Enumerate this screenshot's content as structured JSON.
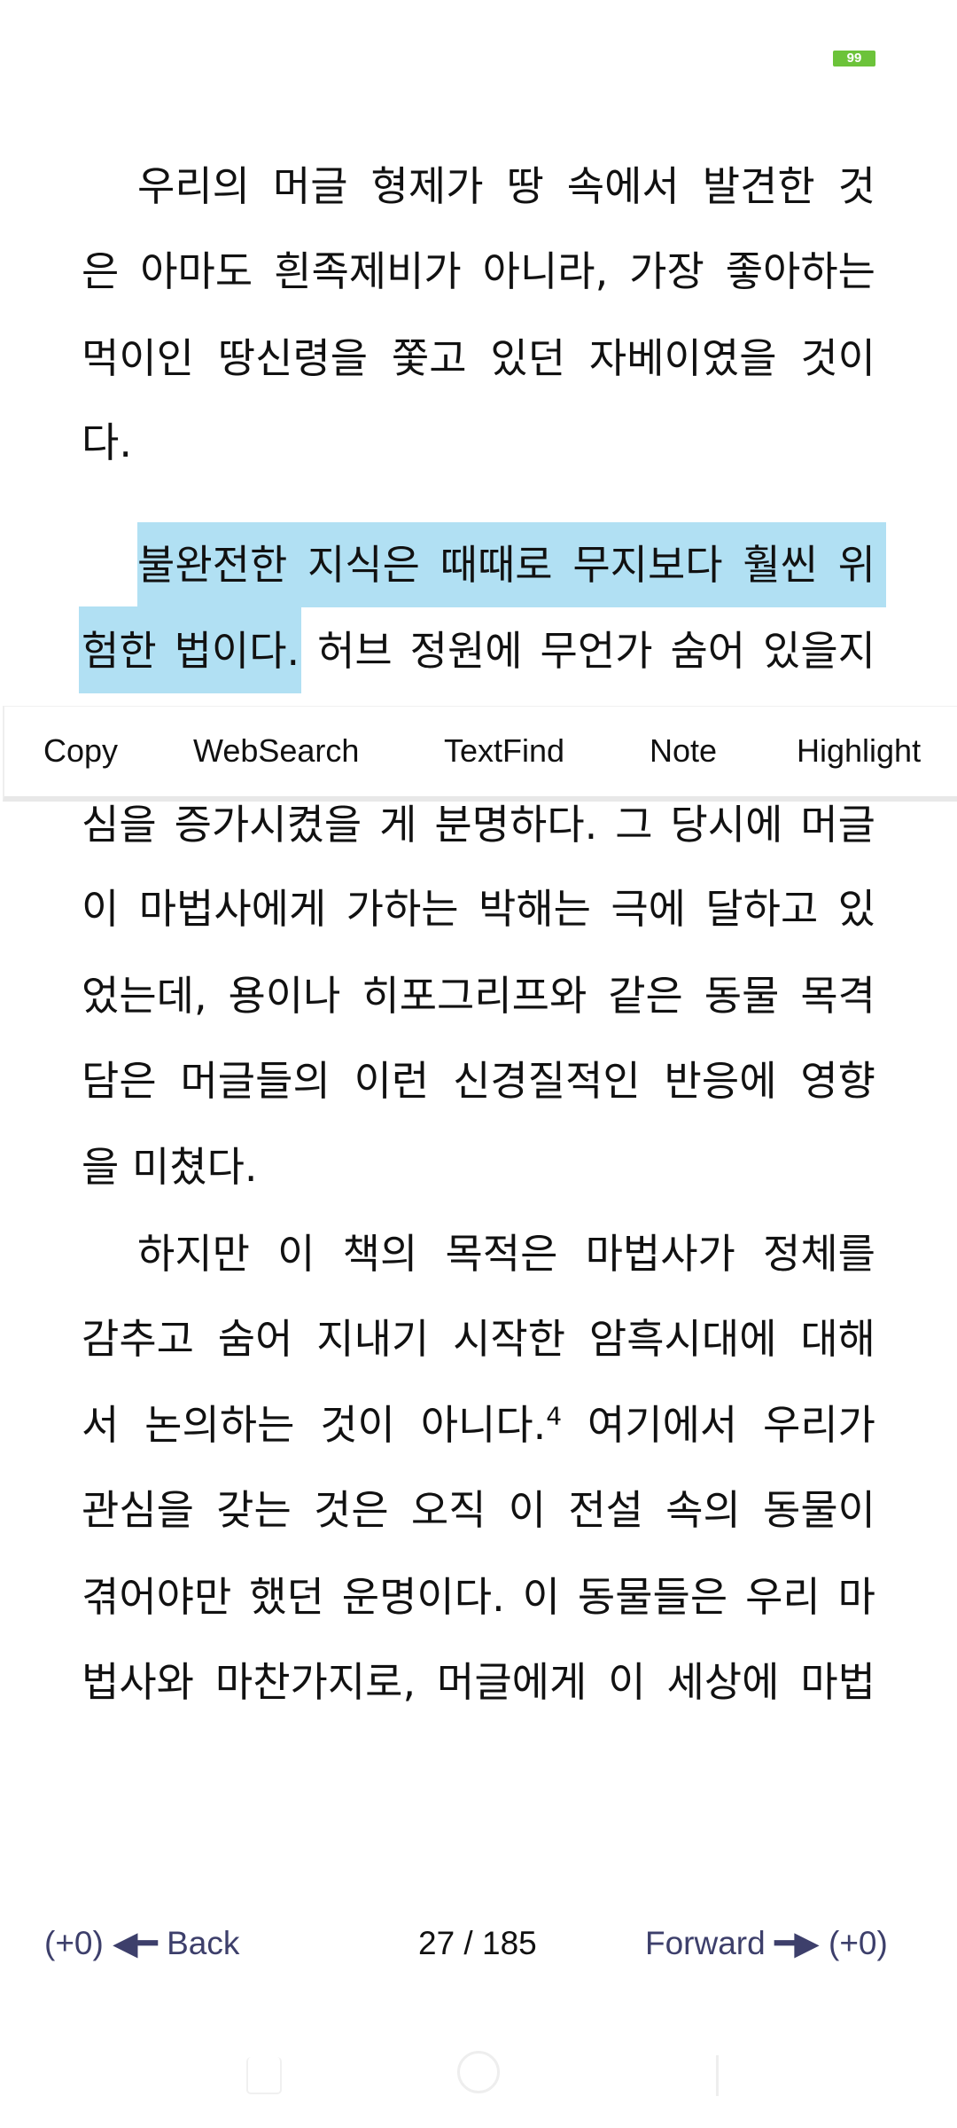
{
  "status_bar": {
    "battery_level": "99",
    "battery_color": "#6cc33a"
  },
  "reader": {
    "highlight_color": "#b1e0f3",
    "lines": [
      "우리의 머글 형제가 땅 속에서 발견한 것",
      "은 아마도 흰족제비가 아니라, 가장 좋아하는",
      "먹이인 땅신령을 쫓고 있던 자베이였을 것이",
      "다.",
      "불완전한 지식은 때때로 무지보다 훨씬 위",
      "험한 법이다.",
      "허브 정원에 무언가 숨어 있을지",
      "심을 증가시켰을 게 분명하다. 그 당시에 머글",
      "이 마법사에게 가하는 박해는 극에 달하고 있",
      "었는데, 용이나 히포그리프와 같은 동물 목격",
      "담은 머글들의 이런 신경질적인 반응에 영향",
      "을 미쳤다.",
      "하지만 이 책의 목적은 마법사가 정체를",
      "감추고 숨어 지내기 시작한 암흑시대에 대해",
      "서 논의하는 것이 아니다.",
      "4",
      " 여기에서 우리가",
      "관심을 갖는 것은 오직 이 전설 속의 동물이",
      "겪어야만 했던 운명이다. 이 동물들은 우리 마",
      "법사와 마찬가지로, 머글에게 이 세상에 마법"
    ]
  },
  "selection_menu": {
    "items": [
      "Copy",
      "WebSearch",
      "TextFind",
      "Note",
      "Highlight"
    ]
  },
  "footer": {
    "back_count": "(+0)",
    "back_label": "Back",
    "page_indicator": "27 / 185",
    "forward_label": "Forward",
    "forward_count": "(+0)",
    "accent_color": "#3d3f6b"
  }
}
